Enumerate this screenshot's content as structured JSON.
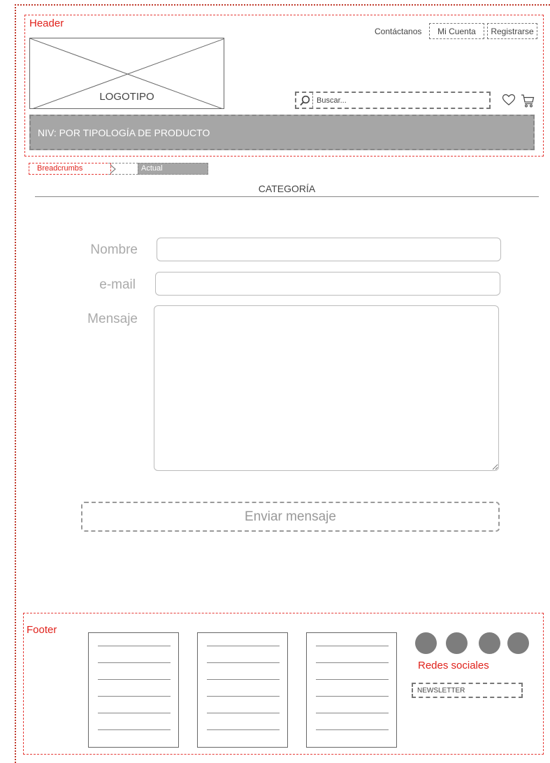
{
  "header": {
    "region_label": "Header",
    "contact_link": "Contáctanos",
    "account_link": "Mi Cuenta",
    "register_link": "Registrarse",
    "logo_text": "LOGOTIPO",
    "search_placeholder": "Buscar...",
    "nav_bar_label": "NIV: POR TIPOLOGÍA DE PRODUCTO"
  },
  "breadcrumbs": {
    "first": "Breadcrumbs",
    "current": "Actual"
  },
  "main": {
    "category_title": "CATEGORÍA",
    "form": {
      "name_label": "Nombre",
      "email_label": "e-mail",
      "message_label": "Mensaje",
      "name_value": "",
      "email_value": "",
      "message_value": "",
      "submit_label": "Enviar mensaje"
    }
  },
  "footer": {
    "region_label": "Footer",
    "social_label": "Redes sociales",
    "newsletter_label": "NEWSLETTER"
  },
  "icons": {
    "search": "search-icon",
    "favorites": "heart-icon",
    "cart": "cart-icon"
  },
  "colors": {
    "region_outline": "#e53935",
    "nav_fill": "#a6a6a6",
    "social_circle": "#7d7d7d"
  }
}
